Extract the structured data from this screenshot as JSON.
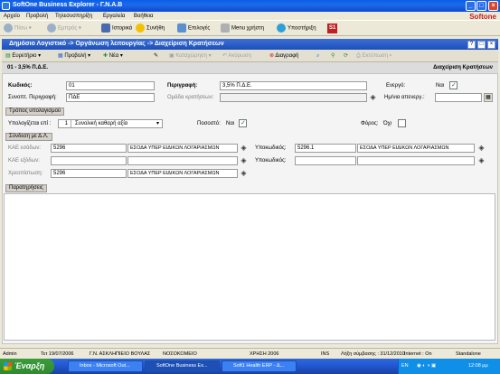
{
  "window": {
    "title": "SoftOne Business Explorer - Γ.Ν.Α.Β"
  },
  "menu": [
    "Αρχείο",
    "Προβολή",
    "Τηλεσυσπηρίξη",
    "Εργαλεία",
    "Βοήθεια"
  ],
  "brand": "Softone",
  "toolbar": {
    "back": "Πίσω",
    "forward": "Εμπρός",
    "history": "Ιστορικά",
    "favorites": "Συνήθη",
    "options": "Επιλογές",
    "user_menu": "Menu χρήστη",
    "support": "Υποστήριξη",
    "s1": "S1"
  },
  "form": {
    "title": "Δημόσιο Λογιστικό -> Οργάνωση λειτουργίας -> Διαχείριση Κρατήσεων",
    "toolbar": {
      "directory": "Ευρετήριο",
      "view": "Προβολή",
      "new": "Νέα",
      "delete": "Διαγραφή",
      "print": "Εκτύπωση",
      "save": "Καταχώρηση",
      "cancel": "Ακύρωση"
    },
    "record_header": "01 - 3,5% Π.Δ.Ε.",
    "record_right": "Διαχείριση Κρατήσεων",
    "code_label": "Κωδικός:",
    "code": "01",
    "desc_label": "Περιγραφή:",
    "desc": "3,5% Π.Δ.Ε.",
    "active_label": "Ενεργό:",
    "active": "Ναι",
    "short_label": "Συνοπτ. Περιγραφή:",
    "short": "ΠΔΕ",
    "group_label": "Ομάδα κρατήσεων:",
    "group": "",
    "inactive_date_label": "Ημ/νια απενεργ.:",
    "inactive_date": "",
    "calc_section": "Τρόπος υπολογισμού",
    "calc_on_label": "Υπολογίζεται επί :",
    "calc_on_code": "1",
    "calc_on": "Συνολική καθαρή αξία",
    "percent_label": "Ποσοστό:",
    "percent": "Ναι",
    "tax_label": "Φόρος:",
    "tax": "Όχι",
    "link_section": "Σύνδεση με Δ.Λ.",
    "kae_in_label": "ΚΑΕ εσόδων:",
    "kae_in_code": "5296",
    "kae_in_desc": "ΕΣΟΔΑ ΥΠΕΡ ΕΙΔΙΚΩΝ ΛΟΓΑΡΙΑΣΜΩΝ",
    "sub1_label": "Υποκωδικός:",
    "sub1_code": "5296.1",
    "sub1_desc": "ΕΣΟΔΑ ΥΠΕΡ ΕΙΔΙΚΩΝ ΛΟΓΑΡΙΑΣΜΩΝ",
    "kae_out_label": "ΚΑΕ εξόδων:",
    "kae_out_code": "",
    "kae_out_desc": "",
    "sub2_label": "Υποκωδικός:",
    "sub2_code": "",
    "sub2_desc": "",
    "credit_label": "Χρεοπίστωση:",
    "credit_code": "5296",
    "credit_desc": "ΕΣΟΔΑ ΥΠΕΡ ΕΙΔΙΚΩΝ ΛΟΓΑΡΙΑΣΜΩΝ",
    "remarks_section": "Παρατηρήσεις"
  },
  "status": {
    "user": "Admin",
    "date": "Τετ 19/07/2006",
    "org": "Γ.Ν. ΑΣΚΛΗΠΙΕΙΟ ΒΟΥΛΑΣ",
    "dept": "ΝΟΣΟΚΟΜΕΙΟ",
    "year": "ΧΡΗΣΗ 2006",
    "ins": "INS",
    "expiry": "Λήξη σύμβασης : 31/12/2010",
    "internet": "Internet : On",
    "mode": "Standalone"
  },
  "taskbar": {
    "start": "Έναρξη",
    "tasks": [
      "Inbox - Microsoft Out...",
      "SoftOne Business Ex...",
      "Soft1 Health ERP - Δ..."
    ],
    "lang": "EN",
    "clock": "12:08 μμ"
  }
}
